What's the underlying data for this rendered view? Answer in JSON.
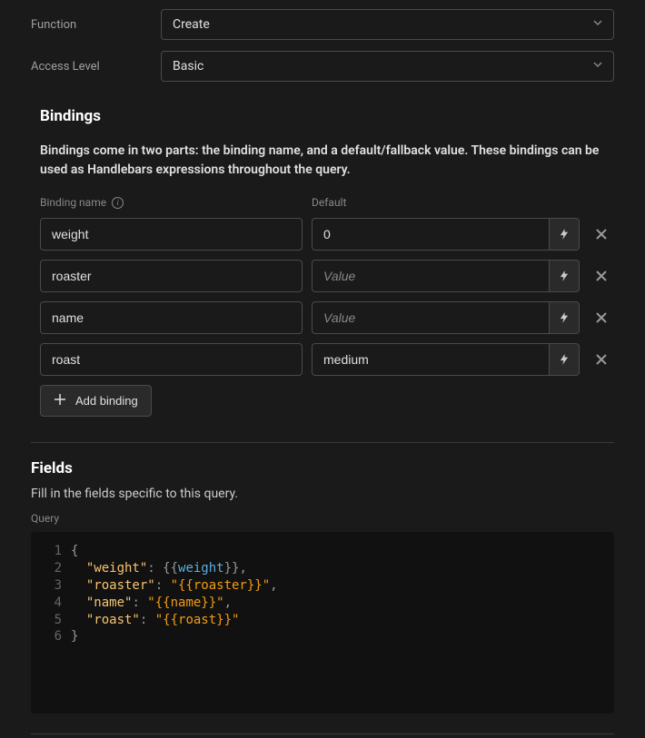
{
  "function": {
    "label": "Function",
    "value": "Create"
  },
  "accessLevel": {
    "label": "Access Level",
    "value": "Basic"
  },
  "bindings": {
    "title": "Bindings",
    "description": "Bindings come in two parts: the binding name, and a default/fallback value. These bindings can be used as Handlebars expressions throughout the query.",
    "colName": "Binding name",
    "colDefault": "Default",
    "placeholder": "Value",
    "rows": [
      {
        "name": "weight",
        "default": "0"
      },
      {
        "name": "roaster",
        "default": ""
      },
      {
        "name": "name",
        "default": ""
      },
      {
        "name": "roast",
        "default": "medium"
      }
    ],
    "addButton": "Add binding"
  },
  "fields": {
    "title": "Fields",
    "description": "Fill in the fields specific to this query.",
    "queryLabel": "Query",
    "code": [
      [
        {
          "t": "punc",
          "v": "{"
        }
      ],
      [
        {
          "t": "pad",
          "v": "  "
        },
        {
          "t": "key",
          "v": "\"weight\""
        },
        {
          "t": "punc",
          "v": ": {{"
        },
        {
          "t": "var",
          "v": "weight"
        },
        {
          "t": "punc",
          "v": "}},"
        }
      ],
      [
        {
          "t": "pad",
          "v": "  "
        },
        {
          "t": "key",
          "v": "\"roaster\""
        },
        {
          "t": "punc",
          "v": ": "
        },
        {
          "t": "str",
          "v": "\"{{roaster}}\""
        },
        {
          "t": "punc",
          "v": ","
        }
      ],
      [
        {
          "t": "pad",
          "v": "  "
        },
        {
          "t": "key",
          "v": "\"name\""
        },
        {
          "t": "punc",
          "v": ": "
        },
        {
          "t": "str",
          "v": "\"{{name}}\""
        },
        {
          "t": "punc",
          "v": ","
        }
      ],
      [
        {
          "t": "pad",
          "v": "  "
        },
        {
          "t": "key",
          "v": "\"roast\""
        },
        {
          "t": "punc",
          "v": ": "
        },
        {
          "t": "str",
          "v": "\"{{roast}}\""
        }
      ],
      [
        {
          "t": "punc",
          "v": "}"
        }
      ]
    ]
  }
}
